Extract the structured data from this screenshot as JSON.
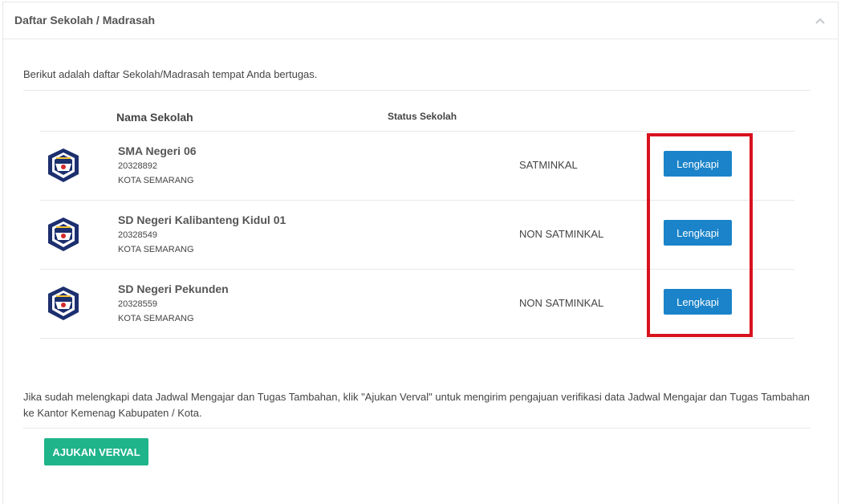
{
  "panel": {
    "title": "Daftar Sekolah / Madrasah",
    "collapse_icon": "chevron-up-icon"
  },
  "intro_text": "Berikut adalah daftar Sekolah/Madrasah tempat Anda bertugas.",
  "table": {
    "columns": [
      "Nama Sekolah",
      "Status Sekolah"
    ],
    "rows": [
      {
        "logo_icon": "tut-wuri-handayani-logo",
        "name": "SMA Negeri 06",
        "npsn": "20328892",
        "city": "KOTA SEMARANG",
        "status": "SATMINKAL",
        "action_label": "Lengkapi"
      },
      {
        "logo_icon": "tut-wuri-handayani-logo",
        "name": "SD Negeri Kalibanteng Kidul 01",
        "npsn": "20328549",
        "city": "KOTA SEMARANG",
        "status": "NON SATMINKAL",
        "action_label": "Lengkapi"
      },
      {
        "logo_icon": "tut-wuri-handayani-logo",
        "name": "SD Negeri Pekunden",
        "npsn": "20328559",
        "city": "KOTA SEMARANG",
        "status": "NON SATMINKAL",
        "action_label": "Lengkapi"
      }
    ]
  },
  "note_text": "Jika sudah melengkapi data Jadwal Mengajar dan Tugas Tambahan, klik \"Ajukan Verval\" untuk mengirim pengajuan verifikasi data Jadwal Mengajar dan Tugas Tambahan ke Kantor Kemenag Kabupaten / Kota.",
  "submit_label": "AJUKAN VERVAL",
  "colors": {
    "primary_button": "#1a83c9",
    "success_button": "#1fb48a",
    "highlight_border": "#d8121f",
    "logo_blue": "#1c2f6e"
  }
}
